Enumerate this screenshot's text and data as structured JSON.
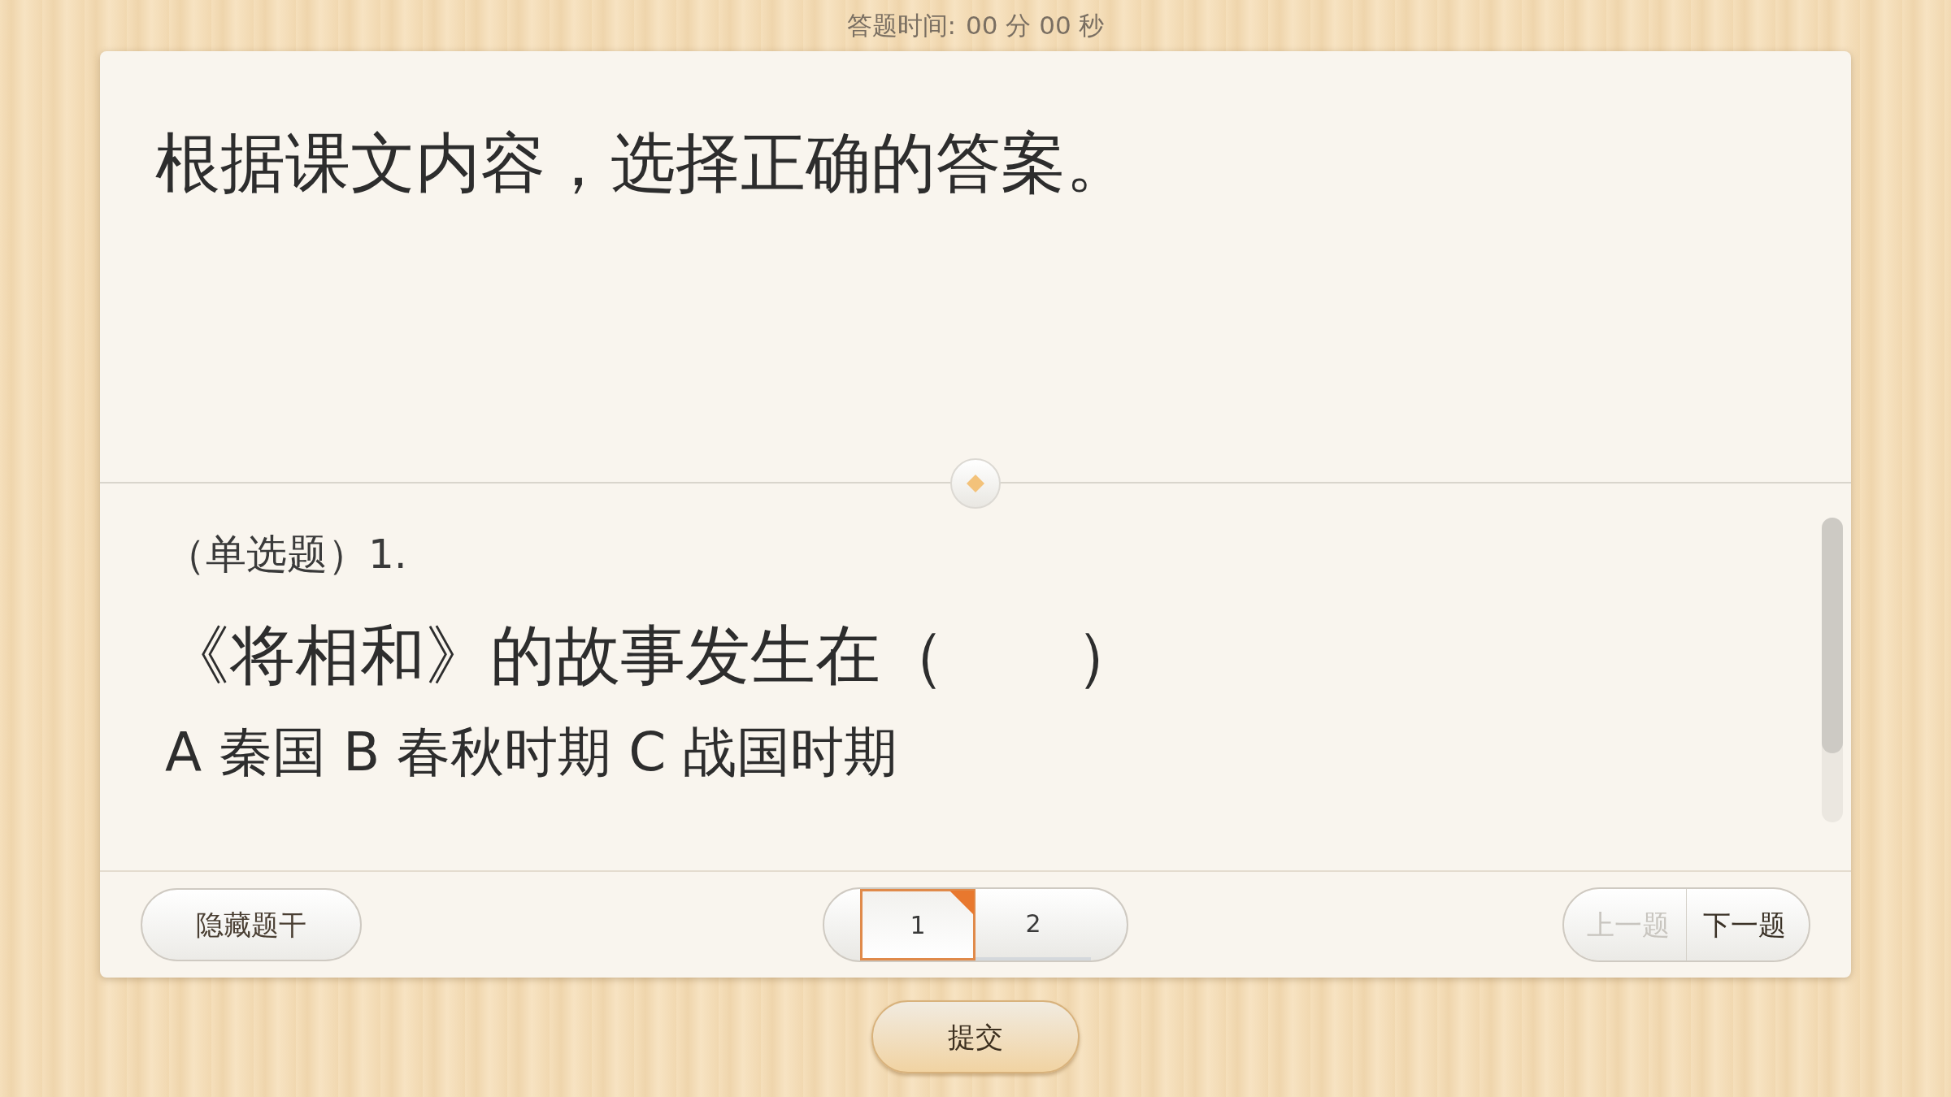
{
  "timer": {
    "label": "答题时间:",
    "minutes": "00",
    "minutes_unit": "分",
    "seconds": "00",
    "seconds_unit": "秒"
  },
  "stem": {
    "text": "根据课文内容，选择正确的答案。"
  },
  "question": {
    "type_label": "（单选题）1.",
    "text": "《将相和》的故事发生在（　　）",
    "options": "A 秦国 B 春秋时期 C 战国时期"
  },
  "footer": {
    "hide_button": "隐藏题干",
    "pages": [
      {
        "label": "1",
        "selected": true
      },
      {
        "label": "2",
        "selected": false
      }
    ],
    "prev": {
      "label": "上一题",
      "disabled": true
    },
    "next": {
      "label": "下一题",
      "disabled": false
    }
  },
  "submit": {
    "label": "提交"
  }
}
